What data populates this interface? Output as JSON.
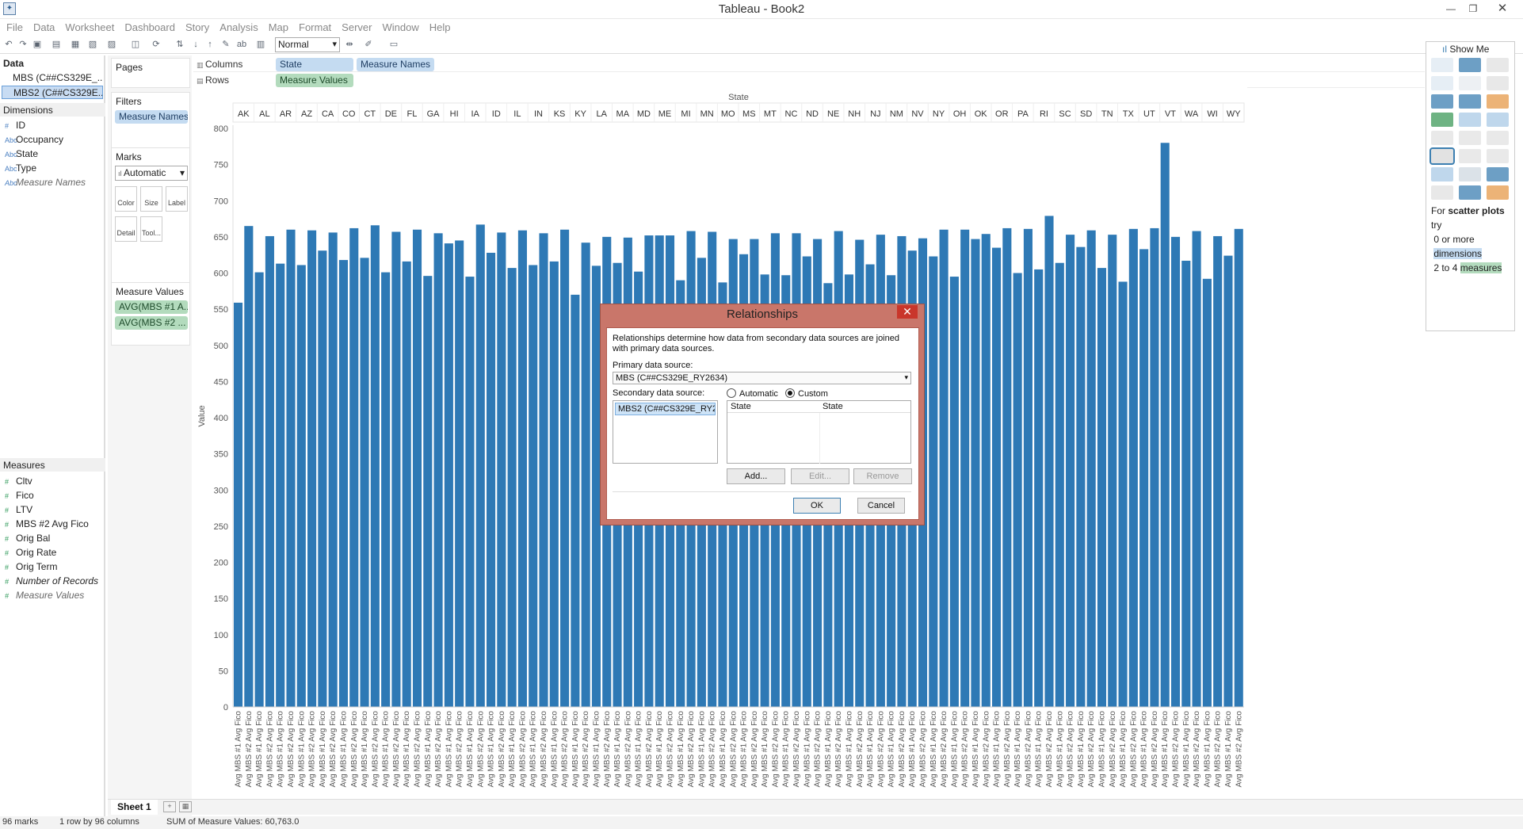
{
  "window": {
    "title": "Tableau - Book2"
  },
  "menu": [
    "File",
    "Data",
    "Worksheet",
    "Dashboard",
    "Story",
    "Analysis",
    "Map",
    "Format",
    "Server",
    "Window",
    "Help"
  ],
  "toolbar": {
    "zoom_value": "Normal"
  },
  "data_pane": {
    "header": "Data",
    "datasources": [
      "MBS (C##CS329E_...",
      "MBS2 (C##CS329E..."
    ],
    "dimensions_header": "Dimensions",
    "dimensions": [
      "ID",
      "Occupancy",
      "State",
      "Type",
      "Measure Names"
    ],
    "measures_header": "Measures",
    "measures": [
      "Cltv",
      "Fico",
      "LTV",
      "MBS #2 Avg Fico",
      "Orig Bal",
      "Orig Rate",
      "Orig Term",
      "Number of Records",
      "Measure Values"
    ]
  },
  "shelves": {
    "pages_label": "Pages",
    "filters_label": "Filters",
    "filters_pill": "Measure Names",
    "marks_label": "Marks",
    "mark_type": "Automatic",
    "mark_buttons": [
      "Color",
      "Size",
      "Label",
      "Detail",
      "Tool..."
    ],
    "measure_values_label": "Measure Values",
    "measure_values_pills": [
      "AVG(MBS #1 A...",
      "AVG(MBS #2 ..."
    ],
    "columns_label": "Columns",
    "columns_pills": [
      "State",
      "Measure Names"
    ],
    "rows_label": "Rows",
    "rows_pills": [
      "Measure Values"
    ]
  },
  "chart_data": {
    "type": "bar",
    "title": "State",
    "ylabel": "Value",
    "ylim": [
      0,
      800
    ],
    "yticks": [
      0,
      50,
      100,
      150,
      200,
      250,
      300,
      350,
      400,
      450,
      500,
      550,
      600,
      650,
      700,
      750,
      800
    ],
    "categories": [
      "AK",
      "AL",
      "AR",
      "AZ",
      "CA",
      "CO",
      "CT",
      "DE",
      "FL",
      "GA",
      "HI",
      "IA",
      "ID",
      "IL",
      "IN",
      "KS",
      "KY",
      "LA",
      "MA",
      "MD",
      "ME",
      "MI",
      "MN",
      "MO",
      "MS",
      "MT",
      "NC",
      "ND",
      "NE",
      "NH",
      "NJ",
      "NM",
      "NV",
      "NY",
      "OH",
      "OK",
      "OR",
      "PA",
      "RI",
      "SC",
      "SD",
      "TN",
      "TX",
      "UT",
      "VT",
      "WA",
      "WI",
      "WY"
    ],
    "series": [
      {
        "name": "Avg MBS #1 Avg Fico",
        "values": [
          559,
          601,
          613,
          611,
          631,
          618,
          621,
          601,
          616,
          596,
          641,
          595,
          628,
          607,
          611,
          616,
          570,
          610,
          614,
          602,
          652,
          590,
          621,
          587,
          626,
          598,
          597,
          623,
          586,
          598,
          612,
          597,
          631,
          623,
          595,
          647,
          635,
          600,
          605,
          614,
          636,
          607,
          588,
          633,
          780,
          617,
          592,
          624
        ]
      },
      {
        "name": "Avg MBS #2 Avg Fico",
        "values": [
          665,
          651,
          660,
          659,
          656,
          662,
          666,
          657,
          660,
          655,
          645,
          667,
          656,
          659,
          655,
          660,
          642,
          650,
          649,
          652,
          652,
          658,
          657,
          647,
          647,
          655,
          655,
          647,
          658,
          646,
          653,
          651,
          648,
          660,
          660,
          654,
          662,
          661,
          679,
          653,
          659,
          653,
          661,
          662,
          650,
          658,
          651,
          661
        ]
      }
    ],
    "xlabels": [
      "Avg MBS #1 Avg Fico",
      "Avg MBS #2 Avg Fico"
    ],
    "color": "#2e79b5"
  },
  "sheet_tab": "Sheet 1",
  "status": {
    "marks": "96 marks",
    "dims": "1 row by 96 columns",
    "sum": "SUM of Measure Values: 60,763.0"
  },
  "show_me": {
    "title": "Show Me",
    "hint_for": "For",
    "hint_chart": "scatter plots",
    "hint_try": "try",
    "hint_line1": "0 or more",
    "hint_dims": "dimensions",
    "hint_line3a": "2 to 4",
    "hint_measures": "measures"
  },
  "dialog": {
    "title": "Relationships",
    "description": "Relationships determine how data from secondary data sources are joined with primary data sources.",
    "primary_label": "Primary data source:",
    "primary_value": "MBS (C##CS329E_RY2634)",
    "secondary_label": "Secondary data source:",
    "radio_automatic": "Automatic",
    "radio_custom": "Custom",
    "secondary_item": "MBS2 (C##CS329E_RY2",
    "map_col1": "State",
    "map_col2": "State",
    "btn_add": "Add...",
    "btn_edit": "Edit...",
    "btn_remove": "Remove",
    "btn_ok": "OK",
    "btn_cancel": "Cancel"
  }
}
